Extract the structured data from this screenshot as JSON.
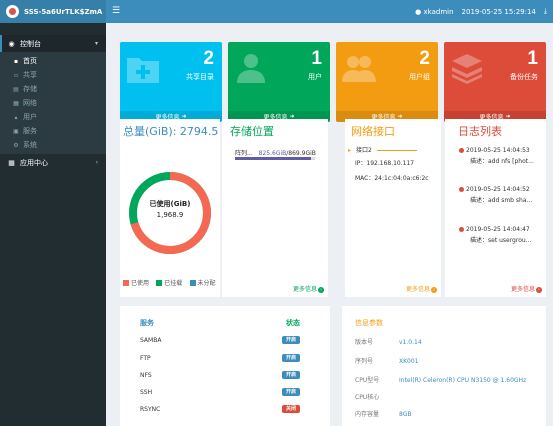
{
  "topbar": {
    "brand": "SSS-5a6UrTLK$ZmA",
    "user": "xkadmin",
    "datetime": "2019-05-25 15:29:14"
  },
  "sidebar": {
    "group_control": "控制台",
    "items": [
      {
        "label": "首页",
        "icon": "home-icon"
      },
      {
        "label": "共享",
        "icon": "share-icon"
      },
      {
        "label": "存储",
        "icon": "storage-icon"
      },
      {
        "label": "网络",
        "icon": "network-icon"
      },
      {
        "label": "用户",
        "icon": "user-icon"
      },
      {
        "label": "服务",
        "icon": "service-icon"
      },
      {
        "label": "系统",
        "icon": "system-icon"
      }
    ],
    "group_apps": "应用中心"
  },
  "info_boxes": [
    {
      "count": "2",
      "label": "共享目录",
      "footer": "更多信息",
      "color": "#00c0ef",
      "icon": "folder-plus-icon"
    },
    {
      "count": "1",
      "label": "用户",
      "footer": "更多信息",
      "color": "#00a65a",
      "icon": "user-icon"
    },
    {
      "count": "2",
      "label": "用户组",
      "footer": "更多信息",
      "color": "#f39c12",
      "icon": "group-icon"
    },
    {
      "count": "1",
      "label": "备份任务",
      "footer": "更多信息",
      "color": "#dd4b39",
      "icon": "layers-icon"
    }
  ],
  "storage": {
    "total_label": "总量(GiB): 2794.5",
    "used_title": "已使用(GiB)",
    "used_value": "1,968.9",
    "used_fraction": 0.704,
    "legend": [
      {
        "label": "已使用",
        "color": "#f56954"
      },
      {
        "label": "已挂载",
        "color": "#00a65a"
      },
      {
        "label": "未分配",
        "color": "#3c8dbc"
      }
    ]
  },
  "location": {
    "title": "存储位置",
    "array_label": "阵列...",
    "array_used": "825.6GiB",
    "array_total": "/869.9GiB",
    "usage_fraction": 0.949,
    "more": "更多信息"
  },
  "network": {
    "title": "网络接口",
    "iface": "接口2",
    "ip": "IP：192.168.10.117",
    "mac": "MAC：24:1c:04:0a:c6:2c",
    "more": "更多信息"
  },
  "logs": {
    "title": "日志列表",
    "entries": [
      {
        "time": "2019-05-25 14:04:53",
        "desc": "描述：add nfs [phot..."
      },
      {
        "time": "2019-05-25 14:04:52",
        "desc": "描述：add smb sha..."
      },
      {
        "time": "2019-05-25 14:04:47",
        "desc": "描述：set usergrou..."
      }
    ],
    "more": "更多信息"
  },
  "services": {
    "col_service": "服务",
    "col_status": "状态",
    "rows": [
      {
        "name": "SAMBA",
        "status": "开启",
        "color": "#3c8dbc"
      },
      {
        "name": "FTP",
        "status": "开启",
        "color": "#3c8dbc"
      },
      {
        "name": "NFS",
        "status": "开启",
        "color": "#3c8dbc"
      },
      {
        "name": "SSH",
        "status": "开启",
        "color": "#3c8dbc"
      },
      {
        "name": "RSYNC",
        "status": "关闭",
        "color": "#dd4b39"
      }
    ]
  },
  "sysinfo": {
    "title": "信息参数",
    "rows": [
      {
        "key": "版本号",
        "value": "v1.0.14"
      },
      {
        "key": "序列号",
        "value": "XK001"
      },
      {
        "key": "CPU型号",
        "value": "Intel(R) Celeron(R) CPU N3150 @ 1.60GHz"
      },
      {
        "key": "CPU核心",
        "value": ""
      },
      {
        "key": "内存容量",
        "value": "8GB"
      }
    ]
  }
}
